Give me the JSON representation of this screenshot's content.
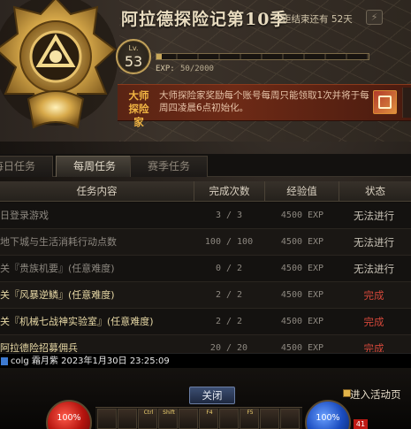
{
  "header": {
    "title": "阿拉德探险记第10季",
    "countdown": "距结束还有 52天",
    "level_label": "Lv.",
    "level": "53",
    "exp_label": "EXP:",
    "exp_value": "50/2000",
    "exp_progress": 0.025,
    "banner_title": "大师探险家",
    "banner_text": "大师探险家奖励每个账号每周只能领取1次并将于每周四凌晨6点初始化。"
  },
  "tabs": [
    {
      "label": "每日任务",
      "active": false
    },
    {
      "label": "每周任务",
      "active": true
    },
    {
      "label": "赛季任务",
      "active": false
    }
  ],
  "table": {
    "headers": [
      "任务内容",
      "完成次数",
      "经验值",
      "状态"
    ],
    "rows": [
      {
        "name": "日登录游戏",
        "count": "3 / 3",
        "exp": "4500 EXP",
        "status": "无法进行",
        "style": "dim",
        "status_style": "nope"
      },
      {
        "name": "地下城与生活消耗行动点数",
        "count": "100 / 100",
        "exp": "4500 EXP",
        "status": "无法进行",
        "style": "dim",
        "status_style": "nope"
      },
      {
        "name": "关『贵族机要』(任意难度)",
        "count": "0 / 2",
        "exp": "4500 EXP",
        "status": "无法进行",
        "style": "dim",
        "status_style": "nope"
      },
      {
        "name": "关『风暴逆鳞』(任意难度)",
        "count": "2 / 2",
        "exp": "4500 EXP",
        "status": "完成",
        "style": "bright",
        "status_style": "done"
      },
      {
        "name": "关『机械七战神实验室』(任意难度)",
        "count": "2 / 2",
        "exp": "4500 EXP",
        "status": "完成",
        "style": "bright",
        "status_style": "done"
      },
      {
        "name": "阿拉德险招募佣兵",
        "count": "20 / 20",
        "exp": "4500 EXP",
        "status": "完成",
        "style": "bright",
        "status_style": "done"
      }
    ]
  },
  "chat": {
    "text": "colg   霜月紫   2023年1月30日 23:25:09"
  },
  "bottom": {
    "close_label": "关闭",
    "activity_label": "进入活动页",
    "hp_pct": "100%",
    "mp_pct": "100%",
    "level_chip": "41",
    "hotbar_slots": [
      "",
      "",
      "Ctrl",
      "Shift",
      "",
      "F4",
      "",
      "F5",
      "",
      ""
    ]
  },
  "colors": {
    "done": "#d2473a",
    "accent_gold": "#c9a85a",
    "banner_title": "#f0b443"
  },
  "icons": {
    "emblem": "gold-crest-emblem",
    "lightning": "lightning-icon",
    "banner_reward": "reward-box-icon"
  }
}
